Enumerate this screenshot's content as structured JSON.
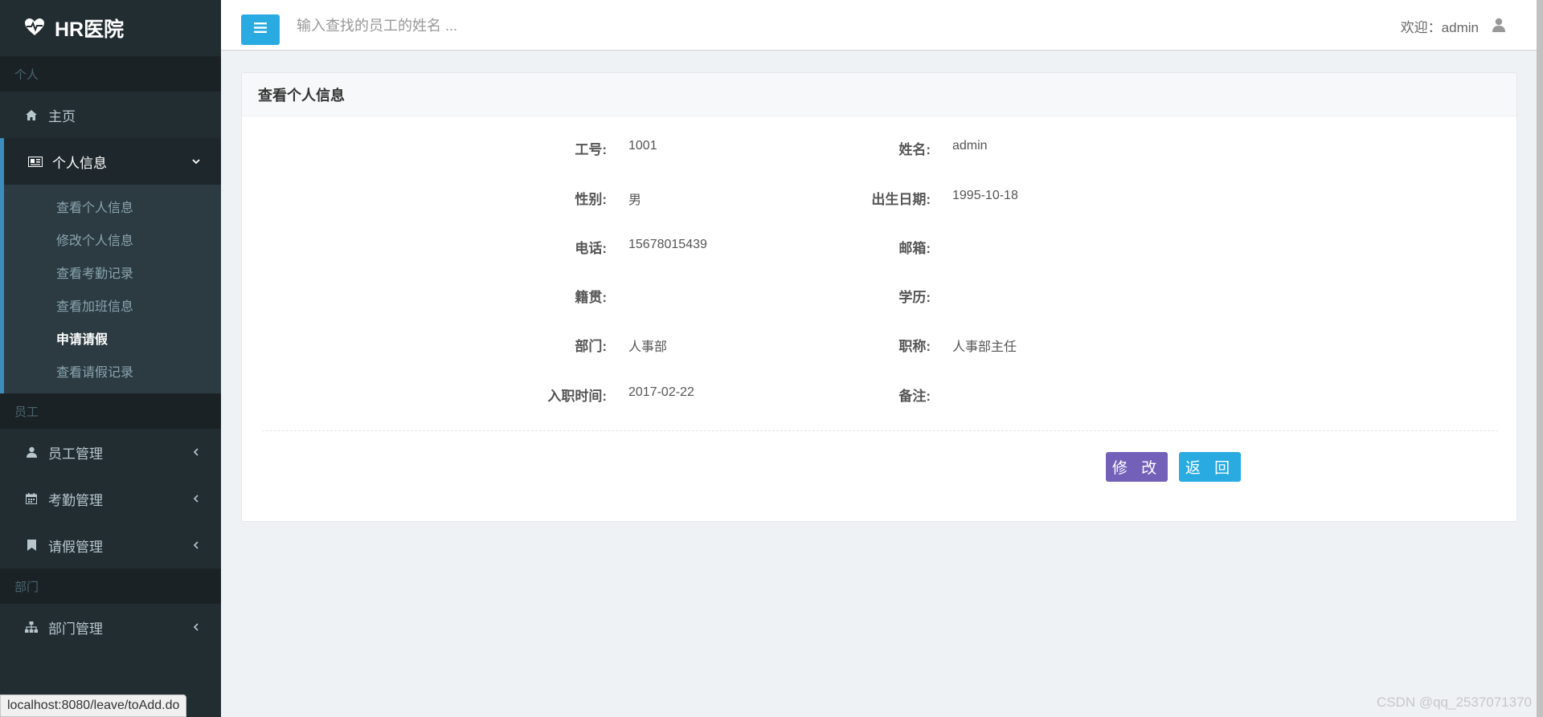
{
  "brand": {
    "title": "HR医院",
    "icon": "heartbeat-icon"
  },
  "sidebar": {
    "sections": {
      "personal": "个人",
      "staff": "员工",
      "department": "部门"
    },
    "home": "主页",
    "personal_info": "个人信息",
    "submenu": [
      "查看个人信息",
      "修改个人信息",
      "查看考勤记录",
      "查看加班信息",
      "申请请假",
      "查看请假记录"
    ],
    "staff_mgmt": "员工管理",
    "attendance_mgmt": "考勤管理",
    "leave_mgmt": "请假管理",
    "dept_mgmt": "部门管理"
  },
  "topbar": {
    "search_placeholder": "输入查找的员工的姓名 ...",
    "welcome": "欢迎：admin"
  },
  "panel": {
    "title": "查看个人信息",
    "fields": {
      "emp_no_label": "工号:",
      "emp_no": "1001",
      "name_label": "姓名:",
      "name": "admin",
      "gender_label": "性别:",
      "gender": "男",
      "birth_label": "出生日期:",
      "birth": "1995-10-18",
      "phone_label": "电话:",
      "phone": "15678015439",
      "email_label": "邮箱:",
      "email": "",
      "origin_label": "籍贯:",
      "origin": "",
      "edu_label": "学历:",
      "edu": "",
      "dept_label": "部门:",
      "dept": "人事部",
      "title_label": "职称:",
      "title": "人事部主任",
      "hire_label": "入职时间:",
      "hire": "2017-02-22",
      "note_label": "备注:",
      "note": ""
    },
    "edit_button": "修 改",
    "back_button": "返 回"
  },
  "status_url": "localhost:8080/leave/toAdd.do",
  "watermark": "CSDN @qq_2537071370",
  "colors": {
    "sidebar_bg": "#222d32",
    "accent": "#29abe2",
    "edit_button": "#7361b9"
  }
}
